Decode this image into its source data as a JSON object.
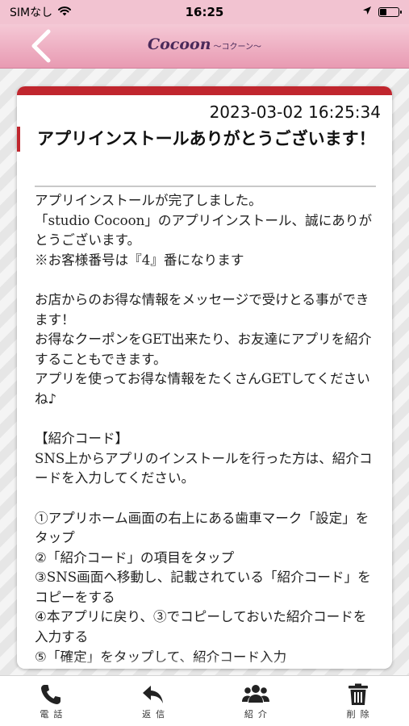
{
  "status_bar": {
    "carrier": "SIMなし",
    "time": "16:25",
    "battery_level": 0.35,
    "icons": [
      "wifi-icon",
      "location-arrow-icon",
      "battery-icon"
    ]
  },
  "header": {
    "back_icon": "chevron-left-icon",
    "logo_main": "Cocoon",
    "logo_sub": "～コクーン～",
    "accent_color": "#e89ab2"
  },
  "message": {
    "date": "2023-03-02 16:25:34",
    "title": "アプリインストールありがとうございます！",
    "accent_color": "#c0262e",
    "body": "アプリインストールが完了しました。\n「studio Cocoon」のアプリインストール、誠にありがとうございます。\n※お客様番号は『4』番になります\n\nお店からのお得な情報をメッセージで受けとる事ができます！\nお得なクーポンをGET出来たり、お友達にアプリを紹介することもできます。\nアプリを使ってお得な情報をたくさんGETしてくださいね♪\n\n【紹介コード】\nSNS上からアプリのインストールを行った方は、紹介コードを入力してください。\n\n①アプリホーム画面の右上にある歯車マーク「設定」をタップ\n②「紹介コード」の項目をタップ\n③SNS画面へ移動し、記載されている「紹介コード」をコピーをする\n④本アプリに戻り、③でコピーしておいた紹介コードを入力する\n⑤「確定」をタップして、紹介コード入力"
  },
  "tabbar": {
    "items": [
      {
        "label": "電話",
        "icon": "phone-icon"
      },
      {
        "label": "返信",
        "icon": "reply-icon"
      },
      {
        "label": "紹介",
        "icon": "users-icon"
      },
      {
        "label": "削除",
        "icon": "trash-icon"
      }
    ]
  }
}
